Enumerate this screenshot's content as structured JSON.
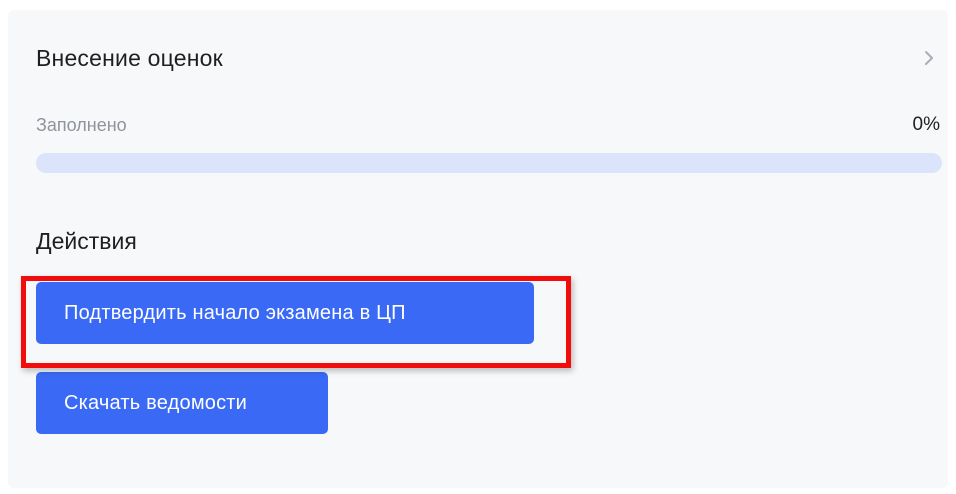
{
  "grading": {
    "title": "Внесение оценок",
    "chevron_icon": "chevron-right-icon",
    "progress_label": "Заполнено",
    "progress_value": "0%",
    "progress_fraction": 0
  },
  "actions": {
    "title": "Действия",
    "confirm_label": "Подтвердить начало экзамена в ЦП",
    "download_label": "Скачать ведомости"
  },
  "colors": {
    "button_bg": "#3a6af5",
    "progress_track": "#dbe4fb",
    "highlight_border": "#f20d0d",
    "card_bg": "#f7f8fa"
  }
}
